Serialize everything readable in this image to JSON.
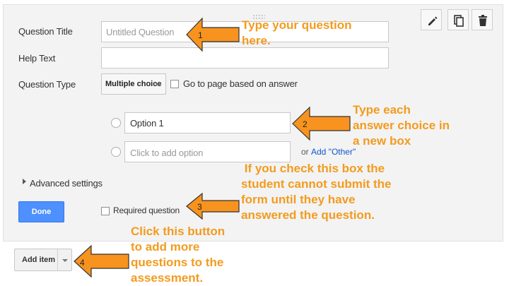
{
  "form": {
    "question_title_label": "Question Title",
    "question_title_placeholder": "Untitled Question",
    "help_text_label": "Help Text",
    "question_type_label": "Question Type",
    "question_type_value": "Multiple choice",
    "go_to_page_label": "Go to page based on answer",
    "option1_value": "Option 1",
    "add_option_placeholder": "Click to add option",
    "or_text": "or",
    "add_other_link": "Add \"Other\"",
    "advanced_settings": "Advanced settings",
    "done_button": "Done",
    "required_question_label": "Required question"
  },
  "toolbar": {
    "icons": [
      "pencil-icon",
      "copy-icon",
      "trash-icon"
    ]
  },
  "footer": {
    "add_item_button": "Add item"
  },
  "annotations": {
    "a1_number": "1",
    "a1_line1": "Type your question",
    "a1_line2": "here.",
    "a2_number": "2",
    "a2_line1": "Type each",
    "a2_line2": "answer choice in",
    "a2_line3": "a new box",
    "a3_number": "3",
    "a3_line1": " If you check this box the",
    "a3_line2": "student cannot submit the",
    "a3_line3": "form until they have",
    "a3_line4": "answered the question.",
    "a4_number": "4",
    "a4_line1": "Click this button",
    "a4_line2": "to add more",
    "a4_line3": "questions to the",
    "a4_line4": "assessment."
  },
  "colors": {
    "arrow_fill": "#f7931e",
    "annotation_text": "#f39b1e",
    "done_button": "#4d90fe",
    "link": "#1155cc"
  }
}
